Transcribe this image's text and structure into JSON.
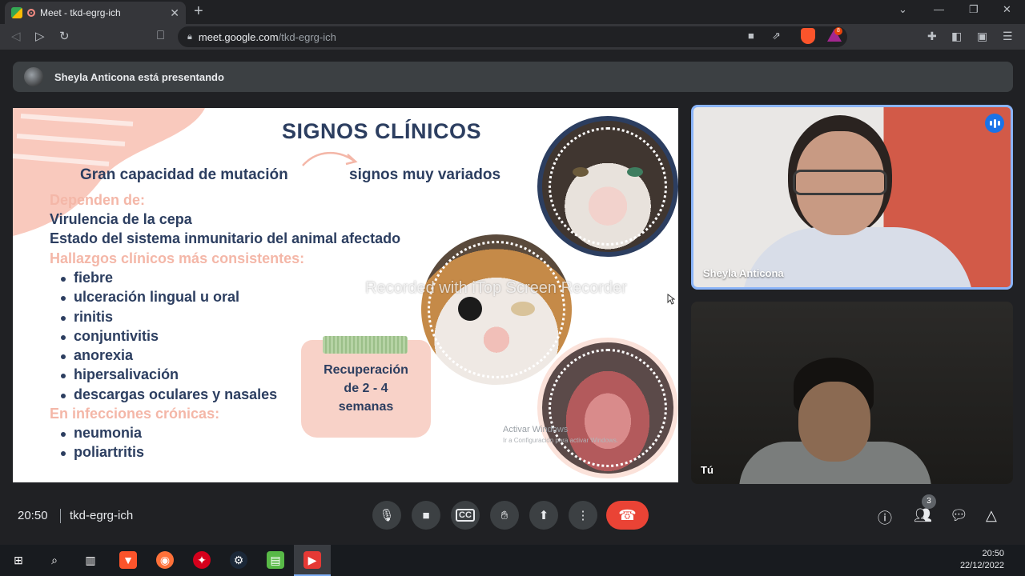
{
  "browser": {
    "tab_title": "Meet - tkd-egrg-ich",
    "url_host": "meet.google.com",
    "url_path": "/tkd-egrg-ich",
    "brave_rewards_badge": "8"
  },
  "presenting_banner": "Sheyla Anticona está presentando",
  "slide": {
    "title": "SIGNOS CLÍNICOS",
    "line_left": "Gran capacidad de mutación",
    "line_right": "signos muy variados",
    "depends_heading": "Dependen de:",
    "depends_items": [
      "Virulencia de la cepa",
      "Estado del sistema inmunitario del animal afectado"
    ],
    "findings_heading": "Hallazgos clínicos más consistentes:",
    "findings_items": [
      "fiebre",
      "ulceración lingual u oral",
      "rinitis",
      "conjuntivitis",
      "anorexia",
      "hipersalivación",
      "descargas oculares y nasales"
    ],
    "chronic_heading": "En infecciones crónicas:",
    "chronic_items": [
      "neumonia",
      "poliartritis"
    ],
    "jar_line1": "Recuperación",
    "jar_line2": "de 2 - 4",
    "jar_line3": "semanas",
    "watermark": "Recorded with iTop Screen Recorder",
    "activate_windows": "Activar Windows",
    "activate_windows_sub": "Ir a Configuración para activar Windows."
  },
  "participants": [
    {
      "name": "Sheyla Anticona",
      "speaking": true
    },
    {
      "name": "Tú",
      "speaking": false
    }
  ],
  "controls": {
    "time": "20:50",
    "meeting_code": "tkd-egrg-ich",
    "people_count": "3"
  },
  "taskbar": {
    "time": "20:50",
    "date": "22/12/2022"
  },
  "colors": {
    "slide_navy": "#2c3e60",
    "slide_pink": "#f4b7a8",
    "hangup_red": "#ea4335",
    "speaking_blue": "#1a73e8"
  }
}
